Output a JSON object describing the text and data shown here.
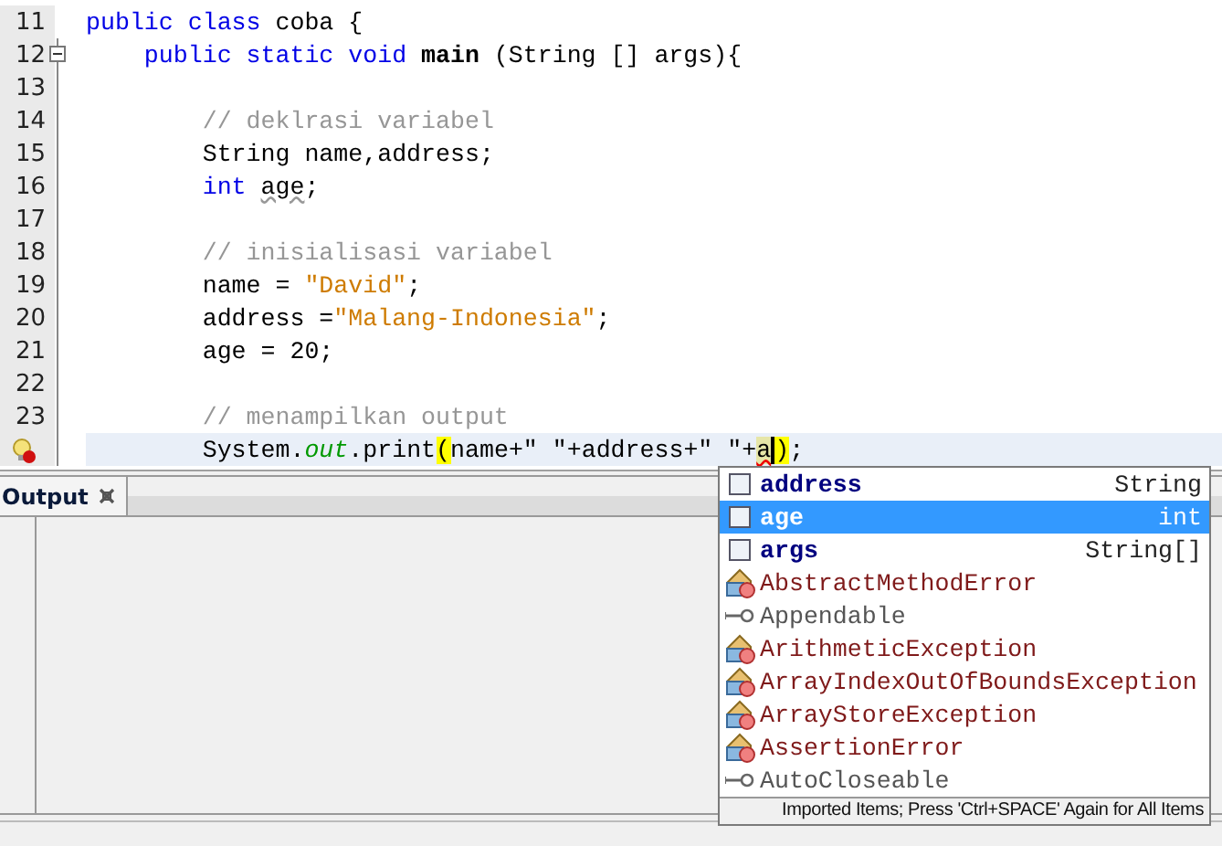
{
  "editor": {
    "lines": [
      {
        "number": "11",
        "fold": false,
        "current": false,
        "hint": false,
        "tokens": [
          {
            "kind": "kw",
            "text": "public class "
          },
          {
            "kind": "plain",
            "text": "coba {"
          }
        ]
      },
      {
        "number": "12",
        "fold": true,
        "current": false,
        "hint": false,
        "tokens": [
          {
            "kind": "kw",
            "text": "    public static void "
          },
          {
            "kind": "method",
            "text": "main"
          },
          {
            "kind": "plain",
            "text": " (String [] args){"
          }
        ]
      },
      {
        "number": "13",
        "fold": false,
        "current": false,
        "hint": false
      },
      {
        "number": "14",
        "fold": false,
        "current": false,
        "hint": false,
        "tokens": [
          {
            "kind": "comment",
            "text": "        // deklrasi variabel"
          }
        ]
      },
      {
        "number": "15",
        "fold": false,
        "current": false,
        "hint": false,
        "tokens": [
          {
            "kind": "plain",
            "text": "        String name,address;"
          }
        ]
      },
      {
        "number": "16",
        "fold": false,
        "current": false,
        "hint": false,
        "tokens": [
          {
            "kind": "kw",
            "text": "        int "
          },
          {
            "kind": "warn",
            "text": "age"
          },
          {
            "kind": "plain",
            "text": ";"
          }
        ]
      },
      {
        "number": "17",
        "fold": false,
        "current": false,
        "hint": false
      },
      {
        "number": "18",
        "fold": false,
        "current": false,
        "hint": false,
        "tokens": [
          {
            "kind": "comment",
            "text": "        // inisialisasi variabel"
          }
        ]
      },
      {
        "number": "19",
        "fold": false,
        "current": false,
        "hint": false,
        "tokens": [
          {
            "kind": "plain",
            "text": "        name = "
          },
          {
            "kind": "string",
            "text": "\"David\""
          },
          {
            "kind": "plain",
            "text": ";"
          }
        ]
      },
      {
        "number": "20",
        "fold": false,
        "current": false,
        "hint": false,
        "tokens": [
          {
            "kind": "plain",
            "text": "        address ="
          },
          {
            "kind": "string",
            "text": "\"Malang-Indonesia\""
          },
          {
            "kind": "plain",
            "text": ";"
          }
        ]
      },
      {
        "number": "21",
        "fold": false,
        "current": false,
        "hint": false,
        "tokens": [
          {
            "kind": "plain",
            "text": "        age = 20;"
          }
        ]
      },
      {
        "number": "22",
        "fold": false,
        "current": false,
        "hint": false
      },
      {
        "number": "23",
        "fold": false,
        "current": false,
        "hint": false,
        "tokens": [
          {
            "kind": "comment",
            "text": "        // menampilkan output"
          }
        ]
      },
      {
        "fold": false,
        "current": true,
        "hint": true,
        "tokens": [
          {
            "kind": "plain",
            "text": "        System."
          },
          {
            "kind": "field",
            "text": "out"
          },
          {
            "kind": "plain",
            "text": ".print"
          },
          {
            "kind": "match",
            "text": "("
          },
          {
            "kind": "plain",
            "text": "name+\" \"+address+\" \"+"
          },
          {
            "kind": "typed",
            "text": "a"
          },
          {
            "kind": "match",
            "text": ")"
          },
          {
            "kind": "plain",
            "text": ";"
          }
        ]
      }
    ]
  },
  "output": {
    "tab": "Output"
  },
  "completion": {
    "items": [
      {
        "kind": "variable",
        "name": "address",
        "type": "String",
        "selected": false
      },
      {
        "kind": "variable",
        "name": "age",
        "type": "int",
        "selected": true
      },
      {
        "kind": "variable",
        "name": "args",
        "type": "String[]",
        "selected": false
      },
      {
        "kind": "class",
        "name": "AbstractMethodError",
        "selected": false
      },
      {
        "kind": "interface",
        "name": "Appendable",
        "selected": false
      },
      {
        "kind": "class",
        "name": "ArithmeticException",
        "selected": false
      },
      {
        "kind": "class",
        "name": "ArrayIndexOutOfBoundsException",
        "selected": false
      },
      {
        "kind": "class",
        "name": "ArrayStoreException",
        "selected": false
      },
      {
        "kind": "class",
        "name": "AssertionError",
        "selected": false
      },
      {
        "kind": "interface",
        "name": "AutoCloseable",
        "selected": false
      }
    ],
    "footer": "Imported Items; Press 'Ctrl+SPACE' Again for All Items"
  }
}
